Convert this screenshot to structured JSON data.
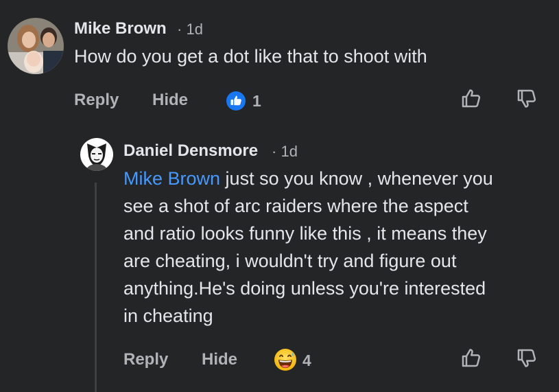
{
  "comment": {
    "author": "Mike Brown",
    "time": "1d",
    "text": "How do you get a dot like that to shoot with",
    "actions": {
      "reply": "Reply",
      "hide": "Hide"
    },
    "reaction": {
      "icon": "like-icon",
      "color": "#1877f2",
      "count": "1"
    }
  },
  "reply": {
    "author": "Daniel Densmore",
    "time": "1d",
    "mention": "Mike Brown",
    "text_lines": [
      " just so you know , whenever you",
      "see a shot of arc raiders where the aspect",
      "and ratio looks funny like this , it means they",
      "are cheating, i wouldn't try and figure out",
      "anything.He's doing unless you're interested",
      "in cheating"
    ],
    "actions": {
      "reply": "Reply",
      "hide": "Hide"
    },
    "reaction": {
      "icon": "grinning-sweat-emoji-icon",
      "count": "4"
    }
  },
  "separator": "·",
  "colors": {
    "background": "#242527",
    "text": "#e4e6eb",
    "muted": "#b0b3b8",
    "mention": "#4599ff"
  }
}
